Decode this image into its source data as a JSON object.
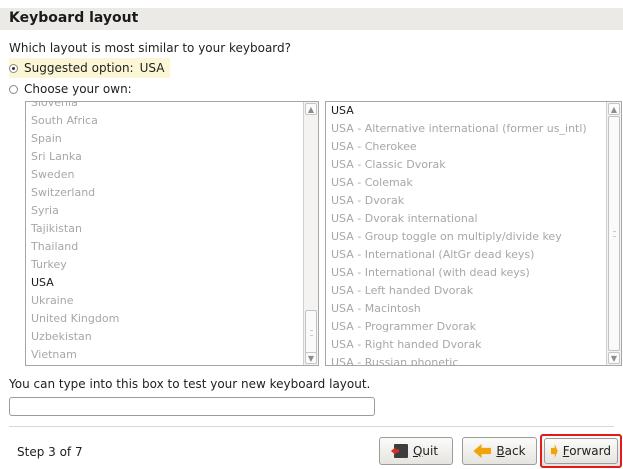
{
  "header": {
    "title": "Keyboard layout"
  },
  "question": "Which layout is most similar to your keyboard?",
  "suggested": {
    "label": "Suggested option:",
    "value": "USA",
    "selected": true
  },
  "choose_own": {
    "label": "Choose your own:",
    "selected": false
  },
  "countries": [
    {
      "label": "Slovenia",
      "active": false
    },
    {
      "label": "South Africa",
      "active": false
    },
    {
      "label": "Spain",
      "active": false
    },
    {
      "label": "Sri Lanka",
      "active": false
    },
    {
      "label": "Sweden",
      "active": false
    },
    {
      "label": "Switzerland",
      "active": false
    },
    {
      "label": "Syria",
      "active": false
    },
    {
      "label": "Tajikistan",
      "active": false
    },
    {
      "label": "Thailand",
      "active": false
    },
    {
      "label": "Turkey",
      "active": false
    },
    {
      "label": "USA",
      "active": true
    },
    {
      "label": "Ukraine",
      "active": false
    },
    {
      "label": "United Kingdom",
      "active": false
    },
    {
      "label": "Uzbekistan",
      "active": false
    },
    {
      "label": "Vietnam",
      "active": false
    }
  ],
  "variants": [
    {
      "label": "USA",
      "active": true
    },
    {
      "label": "USA - Alternative international (former us_intl)",
      "active": false
    },
    {
      "label": "USA - Cherokee",
      "active": false
    },
    {
      "label": "USA - Classic Dvorak",
      "active": false
    },
    {
      "label": "USA - Colemak",
      "active": false
    },
    {
      "label": "USA - Dvorak",
      "active": false
    },
    {
      "label": "USA - Dvorak international",
      "active": false
    },
    {
      "label": "USA - Group toggle on multiply/divide key",
      "active": false
    },
    {
      "label": "USA - International (AltGr dead keys)",
      "active": false
    },
    {
      "label": "USA - International (with dead keys)",
      "active": false
    },
    {
      "label": "USA - Left handed Dvorak",
      "active": false
    },
    {
      "label": "USA - Macintosh",
      "active": false
    },
    {
      "label": "USA - Programmer Dvorak",
      "active": false
    },
    {
      "label": "USA - Right handed Dvorak",
      "active": false
    },
    {
      "label": "USA - Russian phonetic",
      "active": false
    }
  ],
  "test_box": {
    "label": "You can type into this box to test your new keyboard layout.",
    "value": ""
  },
  "footer": {
    "step": "Step 3 of 7",
    "quit_label": "Quit",
    "back_label": "Back",
    "forward_label": "Forward"
  },
  "icons": {
    "quit": "exit-door-icon",
    "back": "arrow-left-icon",
    "forward": "arrow-right-icon"
  },
  "colors": {
    "highlight": "#e01b1b",
    "arrow": "#f0a30a",
    "suggested_bg": "#fbf6d6"
  }
}
